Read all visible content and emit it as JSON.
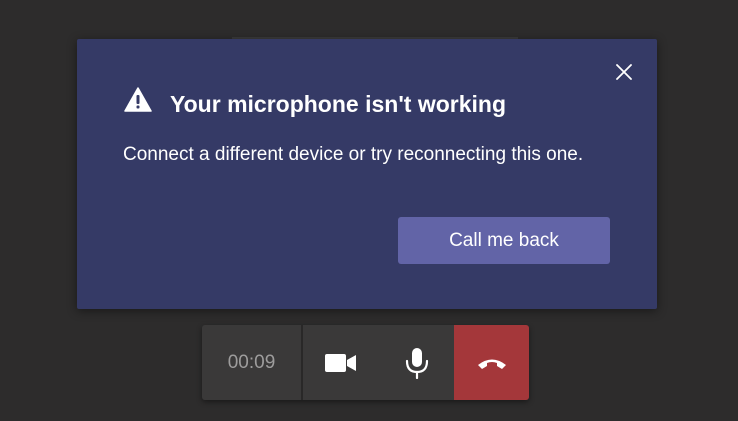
{
  "dialog": {
    "title": "Your microphone isn't working",
    "message": "Connect a different device or try reconnecting this one.",
    "action_button_label": "Call me back",
    "icons": {
      "warning": "warning-icon",
      "close": "close-icon"
    }
  },
  "call_controls": {
    "timer": "00:09",
    "buttons": [
      {
        "name": "camera",
        "icon": "video-camera-icon"
      },
      {
        "name": "microphone",
        "icon": "microphone-icon"
      },
      {
        "name": "hang-up",
        "icon": "hang-up-icon"
      }
    ]
  },
  "colors": {
    "background": "#2d2c2c",
    "dialog_background": "#353a66",
    "primary_button": "#6264a7",
    "control_background": "#3a3939",
    "hangup_red": "#a4373a",
    "text": "#ffffff",
    "timer_text": "#9d9c9c"
  }
}
